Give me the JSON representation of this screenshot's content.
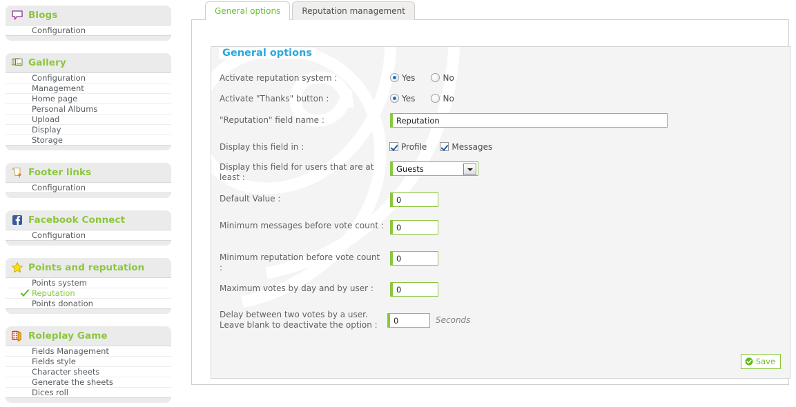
{
  "sidebar": {
    "blocks": [
      {
        "title": "Blogs",
        "icon": "speech-bubble-icon",
        "items": [
          {
            "label": "Configuration",
            "active": false
          }
        ]
      },
      {
        "title": "Gallery",
        "icon": "photos-icon",
        "items": [
          {
            "label": "Configuration",
            "active": false
          },
          {
            "label": "Management",
            "active": false
          },
          {
            "label": "Home page",
            "active": false
          },
          {
            "label": "Personal Albums",
            "active": false
          },
          {
            "label": "Upload",
            "active": false
          },
          {
            "label": "Display",
            "active": false
          },
          {
            "label": "Storage",
            "active": false
          }
        ]
      },
      {
        "title": "Footer links",
        "icon": "scroll-icon",
        "items": [
          {
            "label": "Configuration",
            "active": false
          }
        ]
      },
      {
        "title": "Facebook Connect",
        "icon": "facebook-icon",
        "items": [
          {
            "label": "Configuration",
            "active": false
          }
        ]
      },
      {
        "title": "Points and reputation",
        "icon": "star-icon",
        "items": [
          {
            "label": "Points system",
            "active": false
          },
          {
            "label": "Reputation",
            "active": true
          },
          {
            "label": "Points donation",
            "active": false
          }
        ]
      },
      {
        "title": "Roleplay Game",
        "icon": "dice-icon",
        "items": [
          {
            "label": "Fields Management",
            "active": false
          },
          {
            "label": "Fields style",
            "active": false
          },
          {
            "label": "Character sheets",
            "active": false
          },
          {
            "label": "Generate the sheets",
            "active": false
          },
          {
            "label": "Dices roll",
            "active": false
          }
        ]
      }
    ]
  },
  "tabs": [
    {
      "label": "General options",
      "selected": true
    },
    {
      "label": "Reputation management",
      "selected": false
    }
  ],
  "panel": {
    "legend": "General options",
    "fields": {
      "activate_system": {
        "label": "Activate reputation system :",
        "yes_label": "Yes",
        "no_label": "No",
        "value": "Yes"
      },
      "activate_thanks": {
        "label": "Activate \"Thanks\" button :",
        "yes_label": "Yes",
        "no_label": "No",
        "value": "Yes"
      },
      "field_name": {
        "label": "\"Reputation\" field name :",
        "value": "Reputation",
        "placeholder": ""
      },
      "display_in": {
        "label": "Display this field in :",
        "options": [
          {
            "label": "Profile",
            "checked": true
          },
          {
            "label": "Messages",
            "checked": true
          }
        ]
      },
      "min_group": {
        "label": "Display this field for users that are at least :",
        "value": "Guests",
        "options": [
          "Guests"
        ]
      },
      "default_value": {
        "label": "Default Value :",
        "value": "0"
      },
      "min_messages": {
        "label": "Minimum messages before vote count :",
        "value": "0"
      },
      "min_reputation": {
        "label": "Minimum reputation before vote count :",
        "value": "0"
      },
      "max_votes": {
        "label": "Maximum votes by day and by user :",
        "value": "0"
      },
      "delay": {
        "label": "Delay between two votes by a user. Leave blank to deactivate the option :",
        "value": "0",
        "units": "Seconds"
      }
    },
    "save": {
      "label": "Save",
      "icon": "check-circle-icon"
    }
  },
  "colors": {
    "accent_green": "#8cc63e",
    "legend_blue": "#29a8df",
    "label_gray": "#5c6165",
    "block_bg": "#ebebeb",
    "fieldset_bg": "#f4f4f4",
    "star_yellow": "#f5d615",
    "facebook_blue": "#3b5998"
  }
}
